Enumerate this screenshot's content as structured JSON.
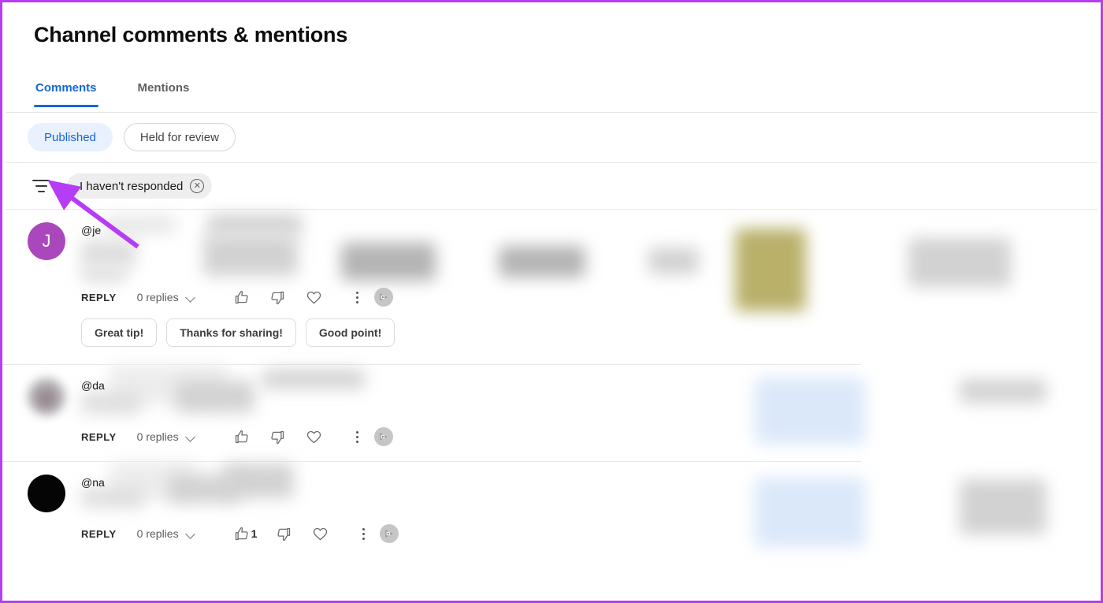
{
  "header": {
    "title": "Channel comments & mentions"
  },
  "tabs": [
    {
      "label": "Comments",
      "active": true
    },
    {
      "label": "Mentions",
      "active": false
    }
  ],
  "status_chips": [
    {
      "label": "Published",
      "selected": true
    },
    {
      "label": "Held for review",
      "selected": false
    }
  ],
  "filter_bar": {
    "filter_icon": "filter-lines-icon",
    "active_filter": {
      "label": "I haven't responded",
      "remove_icon": "close-circle-icon"
    }
  },
  "annotation": {
    "arrow_color": "#b73cf5",
    "points_to": "filter-icon-button"
  },
  "border_color": "#b73cf5",
  "accent_color": "#1666d8",
  "comments": [
    {
      "avatar": {
        "initial": "J",
        "color": "#ab47bc",
        "blurred": false
      },
      "handle": "@je",
      "content_redacted": true,
      "actions": {
        "reply_label": "REPLY",
        "replies_label": "0 replies",
        "expand_icon": "chevron-down-icon",
        "like_icon": "thumbs-up-icon",
        "like_count": "",
        "dislike_icon": "thumbs-down-icon",
        "heart_icon": "heart-icon",
        "more_icon": "kebab-menu-icon",
        "channel_icon": "channel-avatar-icon"
      },
      "quick_replies": [
        "Great tip!",
        "Thanks for sharing!",
        "Good point!"
      ]
    },
    {
      "avatar": {
        "initial": "",
        "color": "#8e8288",
        "blurred": true
      },
      "handle": "@da",
      "content_redacted": true,
      "actions": {
        "reply_label": "REPLY",
        "replies_label": "0 replies",
        "expand_icon": "chevron-down-icon",
        "like_icon": "thumbs-up-icon",
        "like_count": "",
        "dislike_icon": "thumbs-down-icon",
        "heart_icon": "heart-icon",
        "more_icon": "kebab-menu-icon",
        "channel_icon": "channel-avatar-icon"
      },
      "quick_replies": []
    },
    {
      "avatar": {
        "initial": "",
        "color": "#050505",
        "blurred": false
      },
      "handle": "@na",
      "content_redacted": true,
      "actions": {
        "reply_label": "REPLY",
        "replies_label": "0 replies",
        "expand_icon": "chevron-down-icon",
        "like_icon": "thumbs-up-icon",
        "like_count": "1",
        "dislike_icon": "thumbs-down-icon",
        "heart_icon": "heart-icon",
        "more_icon": "kebab-menu-icon",
        "channel_icon": "channel-avatar-icon"
      },
      "quick_replies": []
    }
  ]
}
